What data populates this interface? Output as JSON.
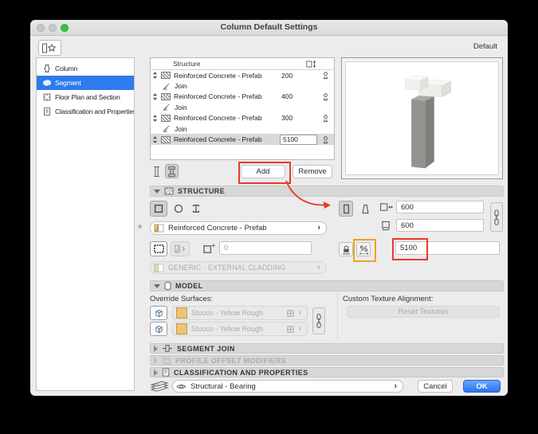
{
  "window": {
    "title": "Column Default Settings",
    "favorites_label": "Default"
  },
  "sidebar": {
    "items": [
      {
        "label": "Column",
        "icon": "column-icon",
        "selected": false
      },
      {
        "label": "Segment",
        "icon": "segment-icon",
        "selected": true
      },
      {
        "label": "Floor Plan and Section",
        "icon": "floor-plan-icon",
        "selected": false
      },
      {
        "label": "Classification and Properties",
        "icon": "classification-icon",
        "selected": false
      }
    ]
  },
  "segment_list": {
    "column_header": "Structure",
    "rows": [
      {
        "kind": "segment",
        "name": "Reinforced Concrete - Prefab",
        "height": "200",
        "selected": false,
        "editing": false
      },
      {
        "kind": "join",
        "name": "Join"
      },
      {
        "kind": "segment",
        "name": "Reinforced Concrete - Prefab",
        "height": "400",
        "selected": false,
        "editing": false
      },
      {
        "kind": "join",
        "name": "Join"
      },
      {
        "kind": "segment",
        "name": "Reinforced Concrete - Prefab",
        "height": "300",
        "selected": false,
        "editing": false
      },
      {
        "kind": "join",
        "name": "Join"
      },
      {
        "kind": "segment",
        "name": "Reinforced Concrete - Prefab",
        "height": "5100",
        "selected": true,
        "editing": true
      }
    ],
    "add_button": "Add",
    "remove_button": "Remove"
  },
  "structure_panel": {
    "title": "STRUCTURE",
    "building_material": "Reinforced Concrete - Prefab",
    "veneer_thickness": "0",
    "cladding_material": "GENERIC - EXTERNAL CLADDING",
    "width": "600",
    "depth": "600",
    "segment_height": "5100"
  },
  "model_panel": {
    "title": "MODEL",
    "override_surfaces_label": "Override Surfaces:",
    "surfaces": [
      "Stucco - Yellow Rough",
      "Stucco - Yellow Rough"
    ],
    "custom_texture_label": "Custom Texture Alignment:",
    "reset_textures_button": "Reset Textures"
  },
  "collapsed_sections": [
    {
      "label": "SEGMENT JOIN",
      "disabled": false
    },
    {
      "label": "PROFILE OFFSET MODIFIERS",
      "disabled": true
    },
    {
      "label": "CLASSIFICATION AND PROPERTIES",
      "disabled": false
    }
  ],
  "footer": {
    "layer": "Structural - Bearing",
    "cancel_button": "Cancel",
    "ok_button": "OK"
  },
  "colors": {
    "selection_blue": "#2d7bee",
    "ok_blue": "#2b73ee",
    "annotation_red": "#e8392a",
    "annotation_orange": "#f0a125",
    "stucco_swatch": "#f0c473",
    "dialog_background": "#ececec"
  },
  "icons": {
    "favorites-icon": "column with star",
    "column-icon": "column capital outline",
    "segment-icon": "3d segment slab",
    "floor-plan-icon": "plan square with axis ticks",
    "classification-icon": "document with lines",
    "height-column-icon": "column with vertical double arrow",
    "reorder-icon": "up-down triangles",
    "fill-swatch": "diagonal hatch",
    "join-icon": "angle with arc",
    "pin-icon": "plumb pin",
    "uniform-column-icon": "plain column",
    "segmented-column-icon": "column with caps",
    "square-profile-icon": "square outline",
    "circle-profile-icon": "circle outline",
    "ibeam-profile-icon": "I profile",
    "building-material-chip": "hatched material chip",
    "veneer-icon": "hatched frame square",
    "core-only-icon": "striped panel with chevron",
    "plus-square-icon": "square with plus",
    "rect-column-icon": "rectangular column outline",
    "tapered-column-icon": "trapezoid column outline",
    "width-icon": "square with horizontal arrows",
    "depth-icon": "square with bottom arrows",
    "chain-link-icon": "chain links",
    "lock-icon": "padlock on base",
    "percent-ruler-icon": "percent over dashed ruler",
    "cube-top-icon": "cube with top face highlighted",
    "cube-side-icon": "cube with side face highlighted",
    "texture-icon": "small grid",
    "segment-join-icon": "joined segments",
    "profile-offset-icon": "dashed offset squares",
    "layers-icon": "stacked layer sheets",
    "eye-icon": "eye",
    "chevron-icon": "›",
    "disclosure-open-icon": "▼",
    "disclosure-closed-icon": "▶"
  }
}
